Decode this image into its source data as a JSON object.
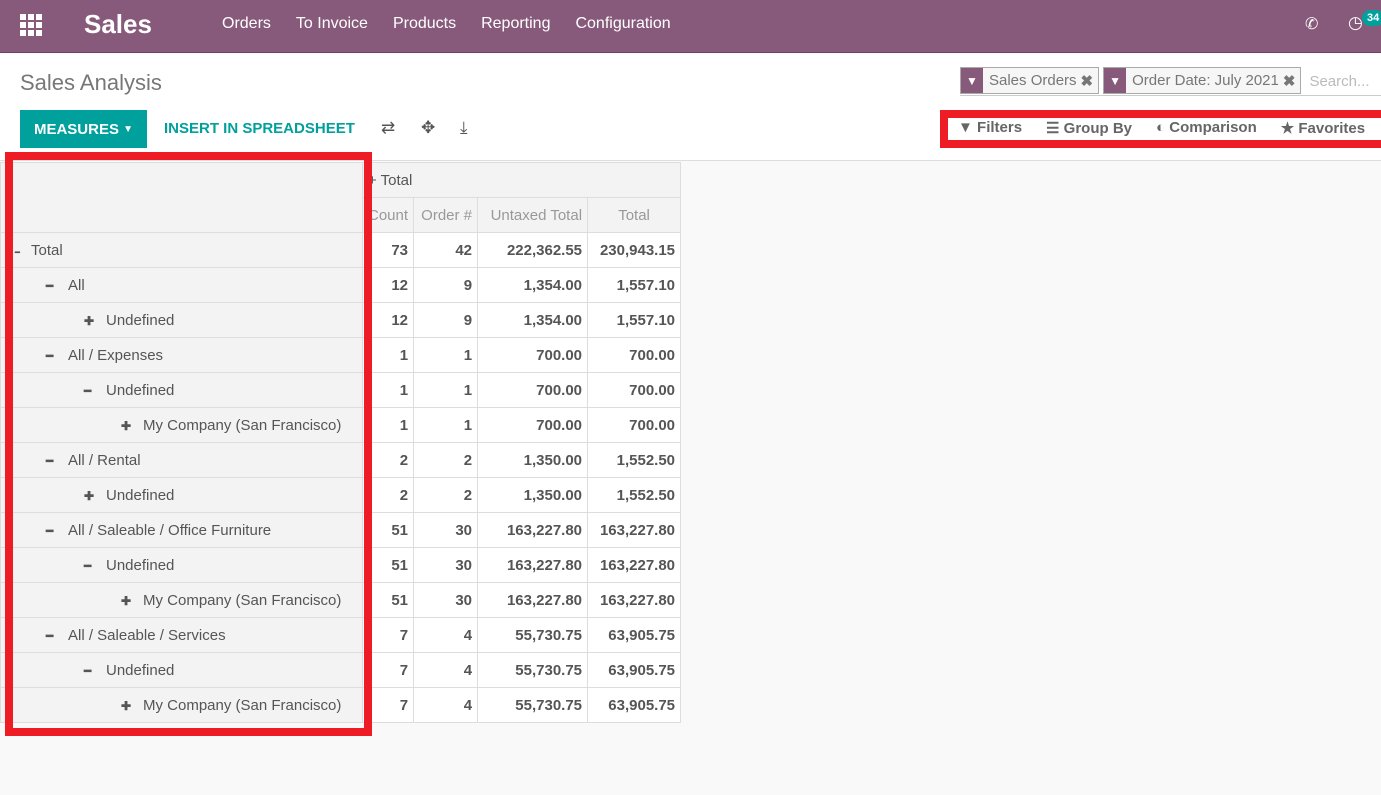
{
  "nav": {
    "app": "Sales",
    "menu": [
      "Orders",
      "To Invoice",
      "Products",
      "Reporting",
      "Configuration"
    ],
    "activity_count": "34"
  },
  "page": {
    "title": "Sales Analysis",
    "measures": "MEASURES",
    "insert": "INSERT IN SPREADSHEET"
  },
  "search": {
    "facets": [
      {
        "label": "Sales Orders"
      },
      {
        "label": "Order Date: July 2021"
      }
    ],
    "placeholder": "Search..."
  },
  "options": {
    "filters": "Filters",
    "group_by": "Group By",
    "comparison": "Comparison",
    "favorites": "Favorites"
  },
  "table": {
    "col_group": "Total",
    "columns": [
      "Count",
      "Order #",
      "Untaxed Total",
      "Total"
    ],
    "rows": [
      {
        "label": "Total",
        "level": 0,
        "toggle": "-",
        "values": [
          "73",
          "42",
          "222,362.55",
          "230,943.15"
        ]
      },
      {
        "label": "All",
        "level": 1,
        "toggle": "-",
        "values": [
          "12",
          "9",
          "1,354.00",
          "1,557.10"
        ]
      },
      {
        "label": "Undefined",
        "level": 2,
        "toggle": "+",
        "values": [
          "12",
          "9",
          "1,354.00",
          "1,557.10"
        ]
      },
      {
        "label": "All / Expenses",
        "level": 1,
        "toggle": "-",
        "values": [
          "1",
          "1",
          "700.00",
          "700.00"
        ]
      },
      {
        "label": "Undefined",
        "level": 2,
        "toggle": "-",
        "values": [
          "1",
          "1",
          "700.00",
          "700.00"
        ]
      },
      {
        "label": "My Company (San Francisco)",
        "level": 3,
        "toggle": "+",
        "values": [
          "1",
          "1",
          "700.00",
          "700.00"
        ]
      },
      {
        "label": "All / Rental",
        "level": 1,
        "toggle": "-",
        "values": [
          "2",
          "2",
          "1,350.00",
          "1,552.50"
        ]
      },
      {
        "label": "Undefined",
        "level": 2,
        "toggle": "+",
        "values": [
          "2",
          "2",
          "1,350.00",
          "1,552.50"
        ]
      },
      {
        "label": "All / Saleable / Office Furniture",
        "level": 1,
        "toggle": "-",
        "values": [
          "51",
          "30",
          "163,227.80",
          "163,227.80"
        ]
      },
      {
        "label": "Undefined",
        "level": 2,
        "toggle": "-",
        "values": [
          "51",
          "30",
          "163,227.80",
          "163,227.80"
        ]
      },
      {
        "label": "My Company (San Francisco)",
        "level": 3,
        "toggle": "+",
        "values": [
          "51",
          "30",
          "163,227.80",
          "163,227.80"
        ]
      },
      {
        "label": "All / Saleable / Services",
        "level": 1,
        "toggle": "-",
        "values": [
          "7",
          "4",
          "55,730.75",
          "63,905.75"
        ]
      },
      {
        "label": "Undefined",
        "level": 2,
        "toggle": "-",
        "values": [
          "7",
          "4",
          "55,730.75",
          "63,905.75"
        ]
      },
      {
        "label": "My Company (San Francisco)",
        "level": 3,
        "toggle": "+",
        "values": [
          "7",
          "4",
          "55,730.75",
          "63,905.75"
        ]
      }
    ]
  },
  "colors": {
    "brand": "#875A7B",
    "accent": "#00A09D",
    "highlight": "#EE1C25"
  }
}
